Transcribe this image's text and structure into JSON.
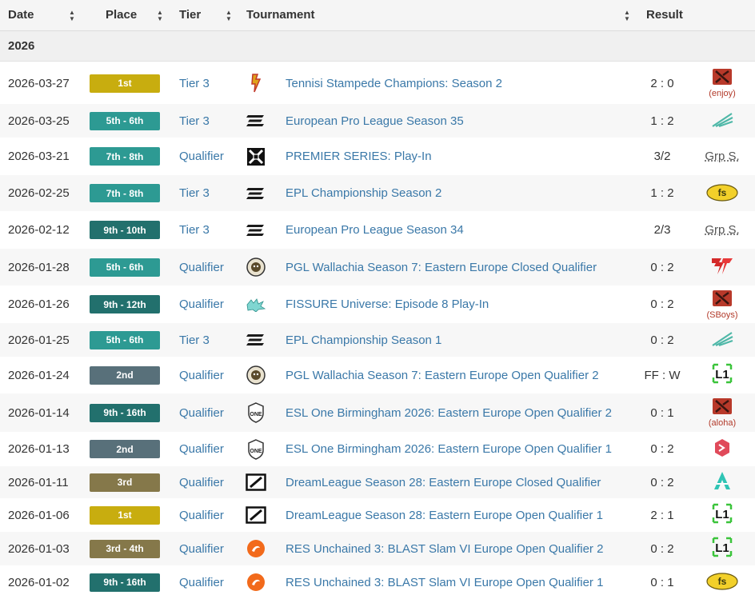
{
  "header": {
    "date": "Date",
    "place": "Place",
    "tier": "Tier",
    "tournament": "Tournament",
    "result": "Result"
  },
  "year_label": "2026",
  "colors": {
    "gold": "#c8ad0f",
    "teal": "#2d9a93",
    "dark_teal": "#22706d",
    "silver": "#58707a",
    "bronze": "#85784a",
    "link": "#3a78a8"
  },
  "rows": [
    {
      "date": "2026-03-27",
      "place": "1st",
      "place_color": "#c8ad0f",
      "tier": "Tier 3",
      "tournament_icon": "tennisi-logo-icon",
      "tournament": "Tennisi Stampede Champions: Season 2",
      "score": "2 : 0",
      "opponent_icon": "dota-team-icon",
      "opponent_tag": "(enjoy)"
    },
    {
      "date": "2026-03-25",
      "place": "5th - 6th",
      "place_color": "#2d9a93",
      "tier": "Tier 3",
      "tournament_icon": "epl-logo-icon",
      "tournament": "European Pro League Season 35",
      "score": "1 : 2",
      "opponent_icon": "claw-team-icon",
      "opponent_tag": ""
    },
    {
      "date": "2026-03-21",
      "place": "7th - 8th",
      "place_color": "#2d9a93",
      "tier": "Qualifier",
      "tournament_icon": "premier-series-logo-icon",
      "tournament": "PREMIER SERIES: Play-In",
      "score": "3/2",
      "opponent_icon": "",
      "opponent_tag": "Grp S."
    },
    {
      "date": "2026-02-25",
      "place": "7th - 8th",
      "place_color": "#2d9a93",
      "tier": "Tier 3",
      "tournament_icon": "epl-logo-icon",
      "tournament": "EPL Championship Season 2",
      "score": "1 : 2",
      "opponent_icon": "yellow-team-icon",
      "opponent_tag": ""
    },
    {
      "date": "2026-02-12",
      "place": "9th - 10th",
      "place_color": "#22706d",
      "tier": "Tier 3",
      "tournament_icon": "epl-logo-icon",
      "tournament": "European Pro League Season 34",
      "score": "2/3",
      "opponent_icon": "",
      "opponent_tag": "Grp S."
    },
    {
      "date": "2026-01-28",
      "place": "5th - 6th",
      "place_color": "#2d9a93",
      "tier": "Qualifier",
      "tournament_icon": "pgl-logo-icon",
      "tournament": "PGL Wallachia Season 7: Eastern Europe Closed Qualifier",
      "score": "0 : 2",
      "opponent_icon": "red-team-icon",
      "opponent_tag": ""
    },
    {
      "date": "2026-01-26",
      "place": "9th - 12th",
      "place_color": "#22706d",
      "tier": "Qualifier",
      "tournament_icon": "fissure-logo-icon",
      "tournament": "FISSURE Universe: Episode 8 Play-In",
      "score": "0 : 2",
      "opponent_icon": "dota-team-icon",
      "opponent_tag": "(SBoys)"
    },
    {
      "date": "2026-01-25",
      "place": "5th - 6th",
      "place_color": "#2d9a93",
      "tier": "Tier 3",
      "tournament_icon": "epl-logo-icon",
      "tournament": "EPL Championship Season 1",
      "score": "0 : 2",
      "opponent_icon": "claw-team-icon",
      "opponent_tag": ""
    },
    {
      "date": "2026-01-24",
      "place": "2nd",
      "place_color": "#58707a",
      "tier": "Qualifier",
      "tournament_icon": "pgl-logo-icon",
      "tournament": "PGL Wallachia Season 7: Eastern Europe Open Qualifier 2",
      "score": "FF : W",
      "opponent_icon": "l1-team-icon",
      "opponent_tag": ""
    },
    {
      "date": "2026-01-14",
      "place": "9th - 16th",
      "place_color": "#22706d",
      "tier": "Qualifier",
      "tournament_icon": "esl-one-logo-icon",
      "tournament": "ESL One Birmingham 2026: Eastern Europe Open Qualifier 2",
      "score": "0 : 1",
      "opponent_icon": "dota-team-icon",
      "opponent_tag": "(aloha)"
    },
    {
      "date": "2026-01-13",
      "place": "2nd",
      "place_color": "#58707a",
      "tier": "Qualifier",
      "tournament_icon": "esl-one-logo-icon",
      "tournament": "ESL One Birmingham 2026: Eastern Europe Open Qualifier 1",
      "score": "0 : 2",
      "opponent_icon": "pink-team-icon",
      "opponent_tag": ""
    },
    {
      "date": "2026-01-11",
      "place": "3rd",
      "place_color": "#85784a",
      "tier": "Qualifier",
      "tournament_icon": "dreamleague-logo-icon",
      "tournament": "DreamLeague Season 28: Eastern Europe Closed Qualifier",
      "score": "0 : 2",
      "opponent_icon": "aurora-team-icon",
      "opponent_tag": ""
    },
    {
      "date": "2026-01-06",
      "place": "1st",
      "place_color": "#c8ad0f",
      "tier": "Qualifier",
      "tournament_icon": "dreamleague-logo-icon",
      "tournament": "DreamLeague Season 28: Eastern Europe Open Qualifier 1",
      "score": "2 : 1",
      "opponent_icon": "l1-team-icon",
      "opponent_tag": ""
    },
    {
      "date": "2026-01-03",
      "place": "3rd - 4th",
      "place_color": "#85784a",
      "tier": "Qualifier",
      "tournament_icon": "res-logo-icon",
      "tournament": "RES Unchained 3: BLAST Slam VI Europe Open Qualifier 2",
      "score": "0 : 2",
      "opponent_icon": "l1-team-icon",
      "opponent_tag": ""
    },
    {
      "date": "2026-01-02",
      "place": "9th - 16th",
      "place_color": "#22706d",
      "tier": "Qualifier",
      "tournament_icon": "res-logo-icon",
      "tournament": "RES Unchained 3: BLAST Slam VI Europe Open Qualifier 1",
      "score": "0 : 1",
      "opponent_icon": "yellow-team-icon",
      "opponent_tag": ""
    }
  ]
}
